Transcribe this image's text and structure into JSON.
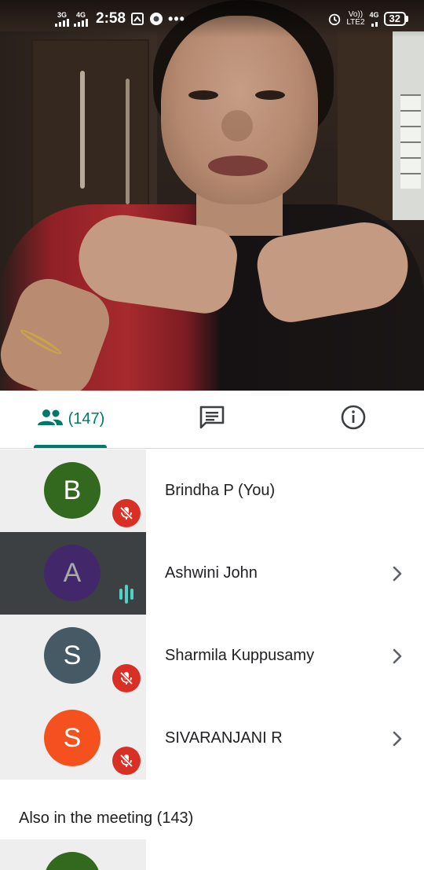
{
  "status_bar": {
    "sim1_label": "3G",
    "sim2_label": "4G",
    "time": "2:58",
    "volte_line1": "Vo))",
    "volte_line2": "LTE2",
    "net_label": "4G",
    "battery": "32",
    "icons": [
      "signal-icon",
      "signal-icon",
      "screenshot-icon",
      "chrome-icon",
      "more-dots-icon",
      "alarm-icon",
      "volte-icon",
      "network-4g-icon",
      "battery-icon"
    ]
  },
  "video": {
    "description_icon": "video-feed"
  },
  "tabs": {
    "people_count": "(147)",
    "icons": [
      "people-icon",
      "chat-icon",
      "info-icon"
    ],
    "active_color": "#00796b"
  },
  "participants": [
    {
      "initial": "B",
      "name": "Brindha P (You)",
      "avatar_color": "#33691e",
      "state": "muted",
      "active": false,
      "chevron": false
    },
    {
      "initial": "A",
      "name": "Ashwini John",
      "avatar_color": "#4a148c",
      "state": "speaking",
      "active": true,
      "chevron": true
    },
    {
      "initial": "S",
      "name": "Sharmila Kuppusamy",
      "avatar_color": "#455a64",
      "state": "muted",
      "active": false,
      "chevron": true
    },
    {
      "initial": "S",
      "name": "SIVARANJANI R",
      "avatar_color": "#f4511e",
      "state": "muted",
      "active": false,
      "chevron": true
    }
  ],
  "also_in_meeting": "Also in the meeting (143)",
  "colors": {
    "mute_red": "#d93025",
    "speaking_teal": "#4fd1c5"
  }
}
